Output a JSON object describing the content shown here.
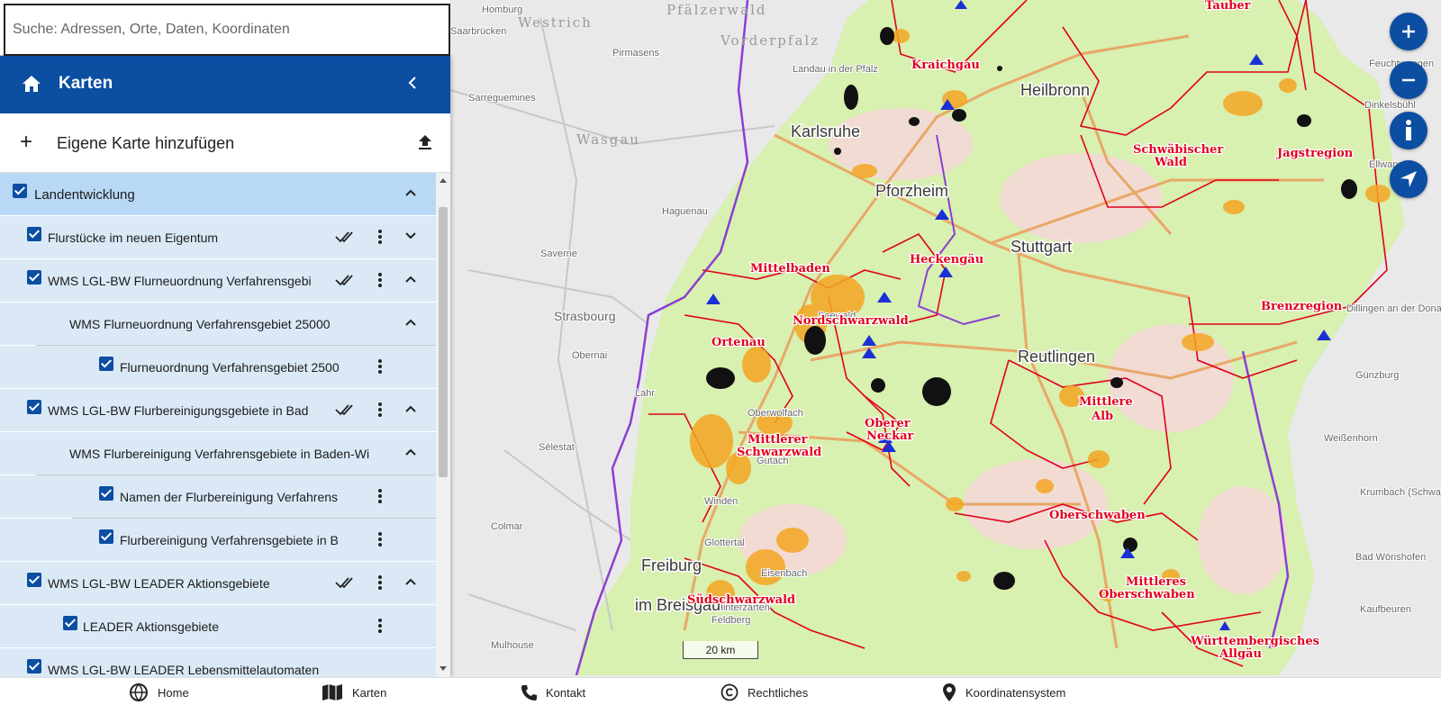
{
  "search": {
    "placeholder": "Suche: Adressen, Orte, Daten, Koordinaten"
  },
  "panel": {
    "title": "Karten",
    "add_map_label": "Eigene Karte hinzufügen"
  },
  "layers": [
    {
      "label": "Landentwicklung",
      "level": 0
    },
    {
      "label": "Flurstücke im neuen Eigentum",
      "level": 1
    },
    {
      "label": "WMS LGL-BW Flurneuordnung Verfahrensgebi",
      "level": 1
    },
    {
      "label": "WMS Flurneuordnung Verfahrensgebiet 25000",
      "level": 2
    },
    {
      "label": "Flurneuordnung Verfahrensgebiet 2500",
      "level": 3
    },
    {
      "label": "WMS LGL-BW Flurbereinigungsgebiete in Bad",
      "level": 1
    },
    {
      "label": "WMS Flurbereinigung Verfahrensgebiete in Baden-Wi",
      "level": 2
    },
    {
      "label": "Namen der Flurbereinigung Verfahrens",
      "level": 3
    },
    {
      "label": "Flurbereinigung Verfahrensgebiete in B",
      "level": 3
    },
    {
      "label": "WMS LGL-BW LEADER Aktionsgebiete",
      "level": 1
    },
    {
      "label": "LEADER Aktionsgebiete",
      "level": 2
    },
    {
      "label": "WMS LGL-BW LEADER Lebensmittelautomaten",
      "level": 1
    }
  ],
  "map": {
    "scale_label": "20 km",
    "cities": [
      "Karlsruhe",
      "Pforzheim",
      "Heilbronn",
      "Stuttgart",
      "Reutlingen",
      "Freiburg",
      "im Breisgau",
      "Strasbourg"
    ],
    "regions": [
      "Kraichgau",
      "Tauber",
      "Schwäbischer",
      "Wald",
      "Jagstregion",
      "Heckengäu",
      "Mittelbaden",
      "Nordschwarzwald",
      "Ortenau",
      "Brenzregion",
      "Mittlerer",
      "Schwarzwald",
      "Oberer",
      "Neckar",
      "Mittlere",
      "Alb",
      "Oberschwaben",
      "Mittleres",
      "Oberschwaben",
      "Südschwarzwald",
      "Württembergisches",
      "Allgäu"
    ],
    "small_places": [
      "Homburg",
      "Saarbrücken",
      "Pirmasens",
      "Sarreguemines",
      "Haguenau",
      "Saverne",
      "Obernai",
      "Sélestat",
      "Colmar",
      "Mulhouse",
      "Landau in der Pfalz",
      "Dillingen an der Donau",
      "Günzburg",
      "Krumbach (Schwaben)",
      "Bad Wörishofen",
      "Kaufbeuren",
      "Weißenhorn",
      "Ellwangen",
      "Dinkelsbühl",
      "Feuchtwangen",
      "Lahr",
      "Oberwolfach",
      "Gutach",
      "Winden",
      "Glottertal",
      "Eisenbach",
      "Feldberg",
      "Hinterzarten",
      "Seewald"
    ],
    "faint": [
      "Westrich",
      "Pfälzerwald",
      "Vorderpfalz",
      "Wasgau"
    ]
  },
  "footer": {
    "home": "Home",
    "karten": "Karten",
    "kontakt": "Kontakt",
    "rechtliches": "Rechtliches",
    "koordinaten": "Koordinatensystem"
  },
  "colors": {
    "accent": "#0b4ea2",
    "region_border": "#e0001b",
    "state_border": "#8a3fd1"
  }
}
